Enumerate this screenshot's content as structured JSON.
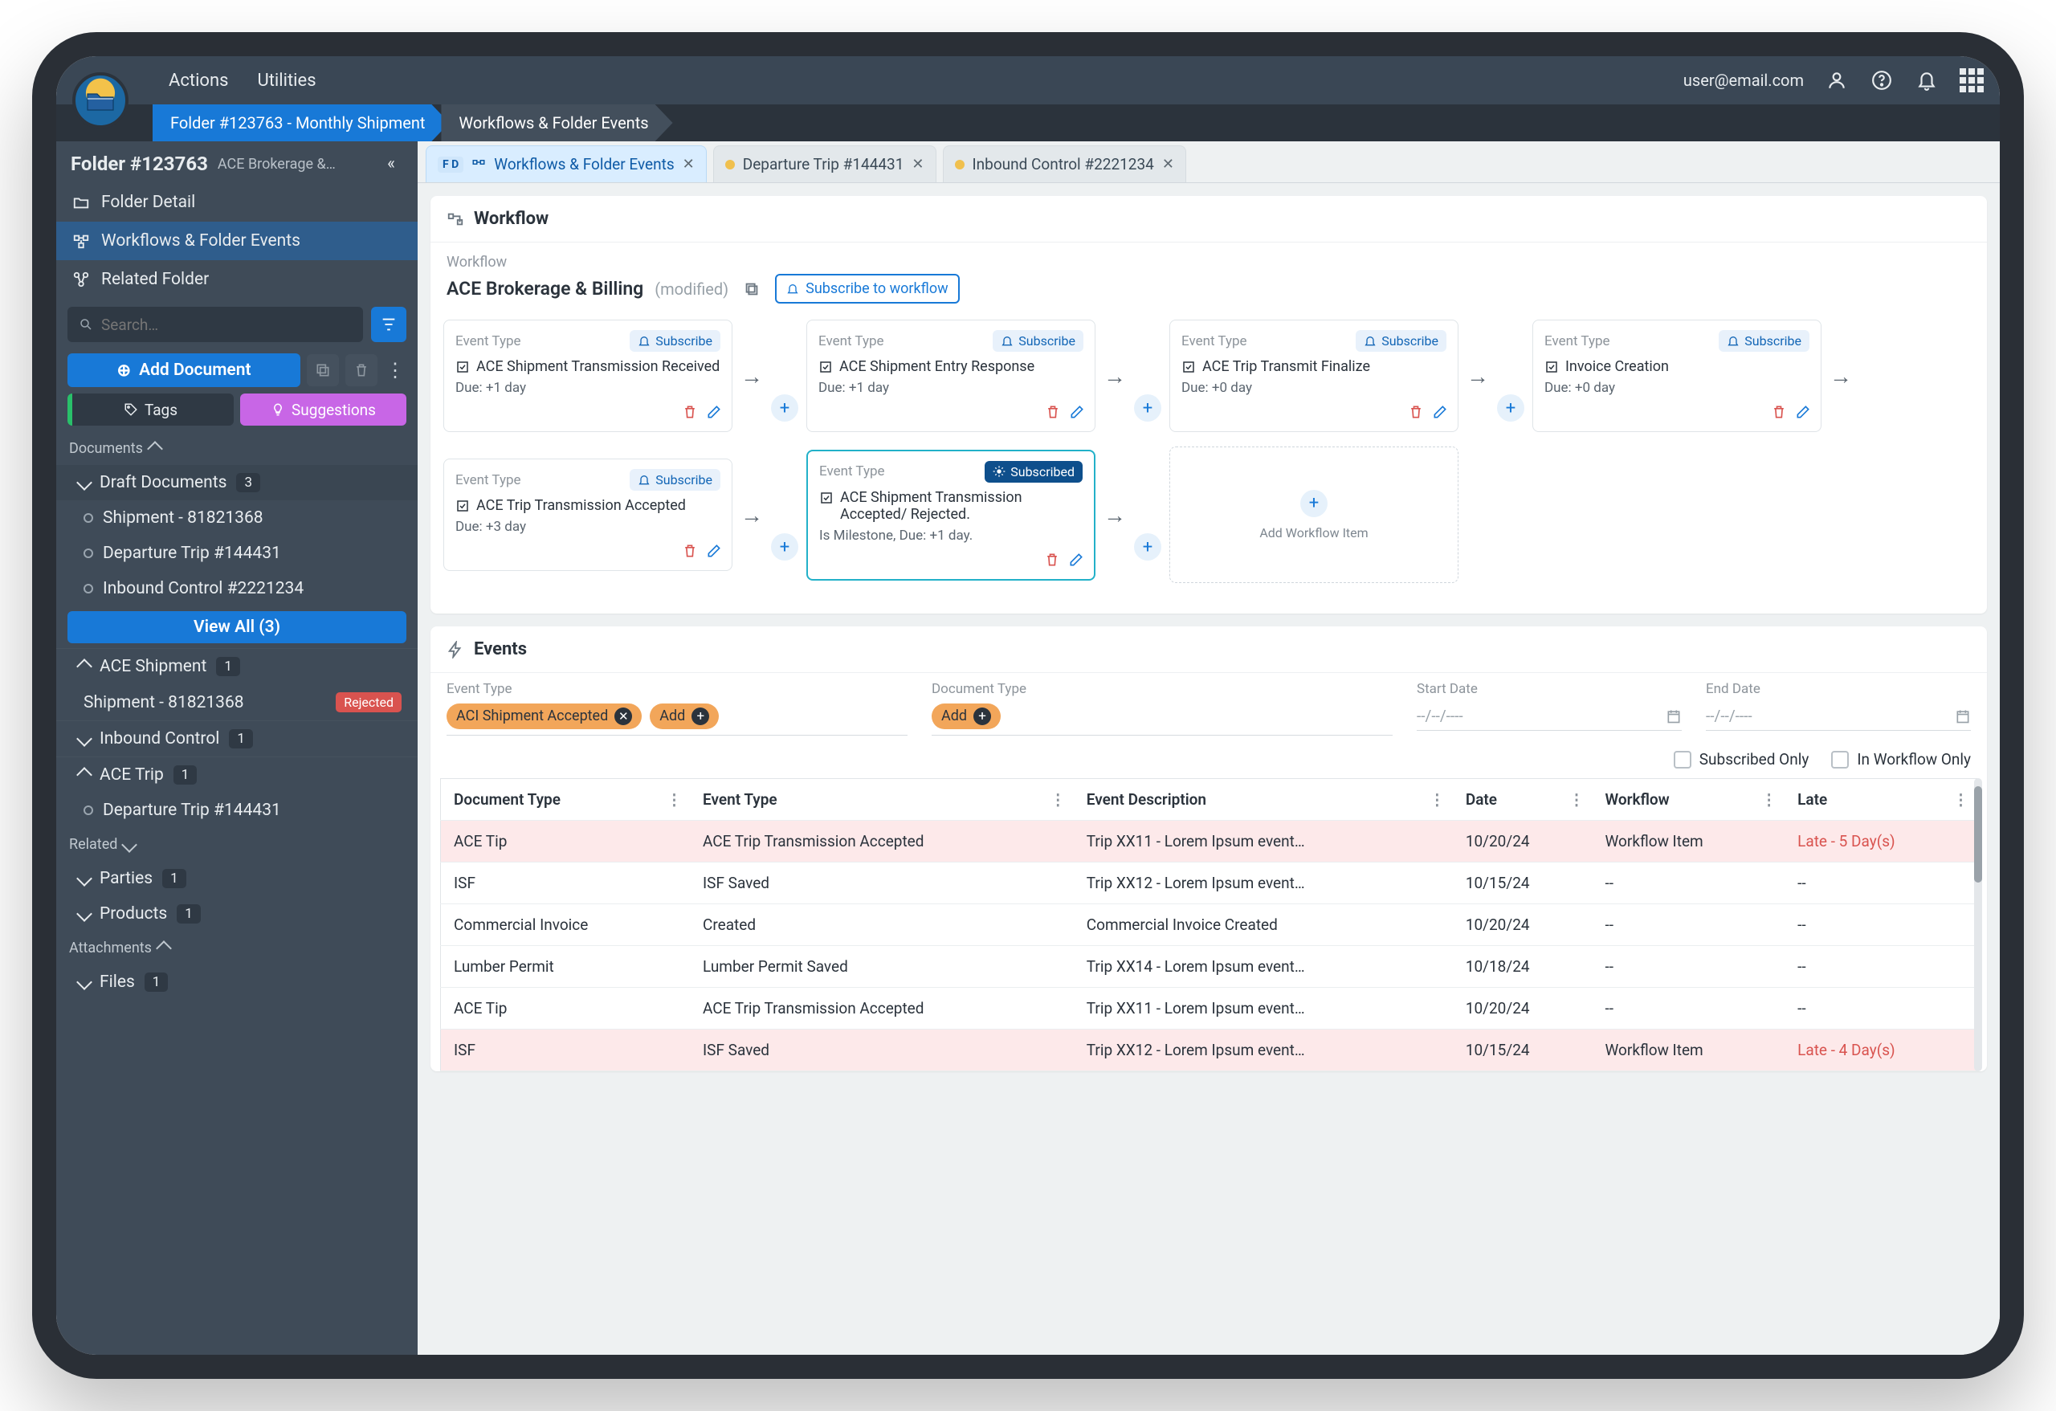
{
  "topbar": {
    "menu": [
      "Actions",
      "Utilities"
    ],
    "user_email": "user@email.com"
  },
  "breadcrumbs": [
    "Folder #123763 - Monthly Shipment",
    "Workflows & Folder Events"
  ],
  "sidebar": {
    "folder_title": "Folder #123763",
    "folder_sub": "ACE Brokerage &…",
    "nav": {
      "detail": "Folder Detail",
      "workflows": "Workflows & Folder Events",
      "related": "Related Folder"
    },
    "search_placeholder": "Search…",
    "add_document": "Add Document",
    "tags_label": "Tags",
    "suggestions_label": "Suggestions",
    "headers": {
      "documents": "Documents",
      "related": "Related",
      "attachments": "Attachments"
    },
    "draft": {
      "label": "Draft Documents",
      "count": "3"
    },
    "drafts": [
      "Shipment - 81821368",
      "Departure Trip #144431",
      "Inbound Control #2221234"
    ],
    "view_all": "View All (3)",
    "groups": [
      {
        "label": "ACE Shipment",
        "count": "1",
        "items": [
          {
            "label": "Shipment - 81821368",
            "badge": "Rejected"
          }
        ]
      },
      {
        "label": "Inbound Control",
        "count": "1",
        "items": []
      },
      {
        "label": "ACE Trip",
        "count": "1",
        "items": [
          {
            "label": "Departure Trip #144431"
          }
        ]
      }
    ],
    "related_groups": [
      {
        "label": "Parties",
        "count": "1"
      },
      {
        "label": "Products",
        "count": "1"
      }
    ],
    "attachment_groups": [
      {
        "label": "Files",
        "count": "1"
      }
    ]
  },
  "tabs": [
    {
      "short": "F D",
      "label": "Workflows & Folder Events",
      "active": true,
      "closable": true
    },
    {
      "label": "Departure Trip #144431",
      "closable": true
    },
    {
      "label": "Inbound Control #2221234",
      "closable": true
    }
  ],
  "workflow": {
    "panel_title": "Workflow",
    "section_label": "Workflow",
    "name": "ACE Brokerage & Billing",
    "modified": "(modified)",
    "subscribe_workflow": "Subscribe to workflow",
    "event_type_label": "Event Type",
    "subscribe_label": "Subscribe",
    "subscribed_label": "Subscribed",
    "add_item_label": "Add Workflow Item",
    "rows": [
      [
        {
          "title": "ACE Shipment Transmission Received",
          "due": "Due: +1 day",
          "subscribe": "btn"
        },
        {
          "title": "ACE Shipment Entry Response",
          "due": "Due: +1 day",
          "subscribe": "btn"
        },
        {
          "title": "ACE Trip Transmit Finalize",
          "due": "Due: +0 day",
          "subscribe": "btn"
        },
        {
          "title": "Invoice Creation",
          "due": "Due: +0 day",
          "subscribe": "btn"
        }
      ],
      [
        {
          "title": "ACE Trip Transmission Accepted",
          "due": "Due: +3 day",
          "subscribe": "btn"
        },
        {
          "title": "ACE Shipment Transmission Accepted/ Rejected.",
          "due": "Is Milestone, Due: +1 day.",
          "subscribe": "done",
          "hl": true
        },
        {
          "add": true
        }
      ]
    ]
  },
  "events": {
    "panel_title": "Events",
    "filters": {
      "event_type_label": "Event Type",
      "event_type_chip": "ACI Shipment Accepted",
      "add_label": "Add",
      "doc_type_label": "Document Type",
      "start_date_label": "Start Date",
      "end_date_label": "End Date",
      "date_placeholder": "--/--/----",
      "subscribed_only": "Subscribed Only",
      "in_workflow_only": "In Workflow Only"
    },
    "columns": [
      "Document Type",
      "Event Type",
      "Event Description",
      "Date",
      "Workflow",
      "Late"
    ],
    "rows": [
      {
        "doc": "ACE Tip",
        "et": "ACE Trip Transmission Accepted",
        "desc": "Trip XX11 - Lorem Ipsum event…",
        "date": "10/20/24",
        "wf": "Workflow Item",
        "late": "Late - 5 Day(s)",
        "is_late": true
      },
      {
        "doc": "ISF",
        "et": "ISF Saved",
        "desc": "Trip XX12 - Lorem Ipsum event…",
        "date": "10/15/24",
        "wf": "--",
        "late": "--"
      },
      {
        "doc": "Commercial Invoice",
        "et": "Created",
        "desc": "Commercial Invoice Created",
        "date": "10/20/24",
        "wf": "--",
        "late": "--"
      },
      {
        "doc": "Lumber Permit",
        "et": "Lumber Permit Saved",
        "desc": "Trip XX14 - Lorem Ipsum event…",
        "date": "10/18/24",
        "wf": "--",
        "late": "--"
      },
      {
        "doc": "ACE Tip",
        "et": "ACE Trip Transmission Accepted",
        "desc": "Trip XX11 - Lorem Ipsum event…",
        "date": "10/20/24",
        "wf": "--",
        "late": "--"
      },
      {
        "doc": "ISF",
        "et": "ISF Saved",
        "desc": "Trip XX12 - Lorem Ipsum event…",
        "date": "10/15/24",
        "wf": "Workflow Item",
        "late": "Late - 4 Day(s)",
        "is_late": true
      }
    ]
  }
}
